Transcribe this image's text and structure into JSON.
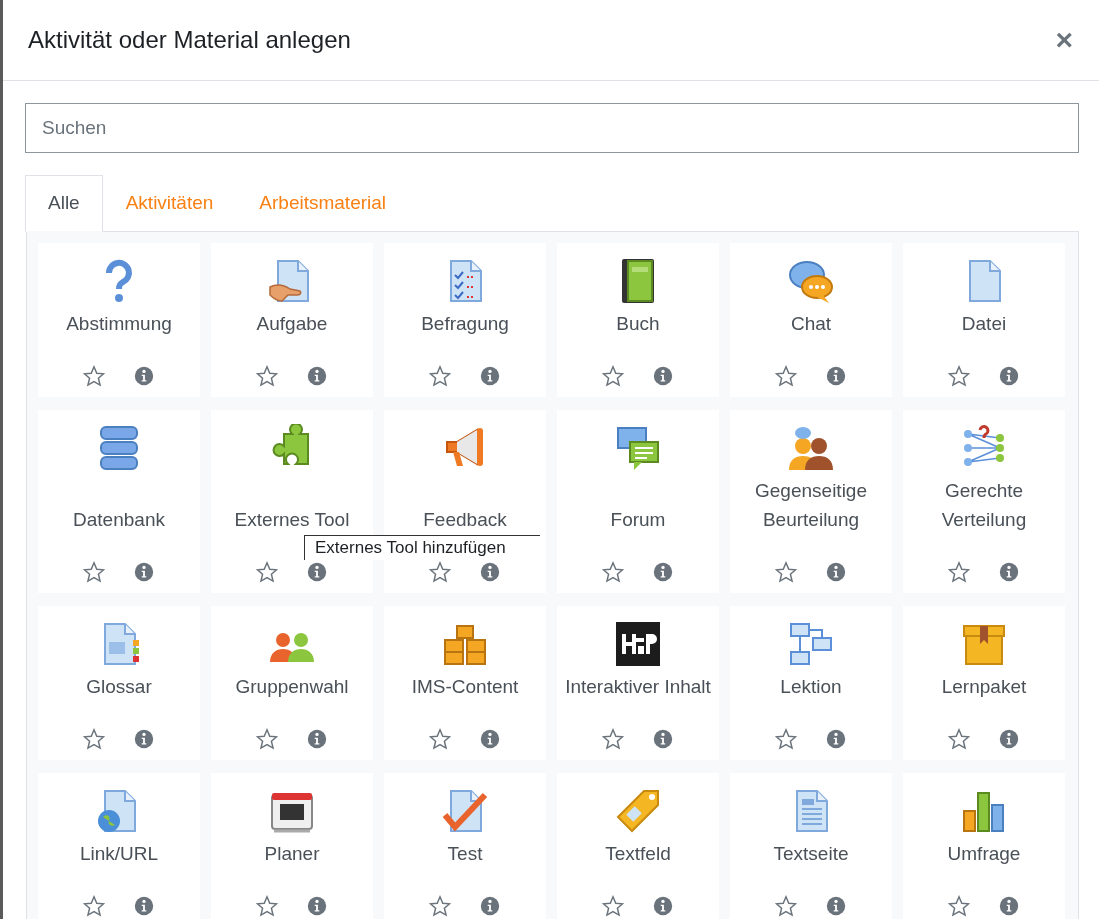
{
  "dialog": {
    "title": "Aktivität oder Material anlegen",
    "close": "×"
  },
  "search": {
    "placeholder": "Suchen"
  },
  "tabs": [
    {
      "label": "Alle",
      "selected": true
    },
    {
      "label": "Aktivitäten",
      "selected": false
    },
    {
      "label": "Arbeitsmaterial",
      "selected": false
    }
  ],
  "items": [
    {
      "label": "Abstimmung",
      "starred": false
    },
    {
      "label": "Aufgabe",
      "starred": false
    },
    {
      "label": "Befragung",
      "starred": false
    },
    {
      "label": "Buch",
      "starred": false
    },
    {
      "label": "Chat",
      "starred": false
    },
    {
      "label": "Datei",
      "starred": false
    },
    {
      "label": "Datenbank",
      "starred": false
    },
    {
      "label": "Externes Tool",
      "starred": false
    },
    {
      "label": "Feedback",
      "starred": false
    },
    {
      "label": "Forum",
      "starred": false
    },
    {
      "label": "Gegenseitige Beurteilung",
      "starred": false
    },
    {
      "label": "Gerechte Verteilung",
      "starred": false
    },
    {
      "label": "Glossar",
      "starred": false
    },
    {
      "label": "Gruppenwahl",
      "starred": false
    },
    {
      "label": "IMS-Content",
      "starred": false
    },
    {
      "label": "Interaktiver Inhalt",
      "starred": false
    },
    {
      "label": "Lektion",
      "starred": false
    },
    {
      "label": "Lernpaket",
      "starred": false
    },
    {
      "label": "Link/URL",
      "starred": false
    },
    {
      "label": "Planer",
      "starred": false
    },
    {
      "label": "Test",
      "starred": false
    },
    {
      "label": "Textfeld",
      "starred": false
    },
    {
      "label": "Textseite",
      "starred": false
    },
    {
      "label": "Umfrage",
      "starred": false
    }
  ],
  "tooltip": {
    "text": "Externes Tool hinzufügen"
  }
}
